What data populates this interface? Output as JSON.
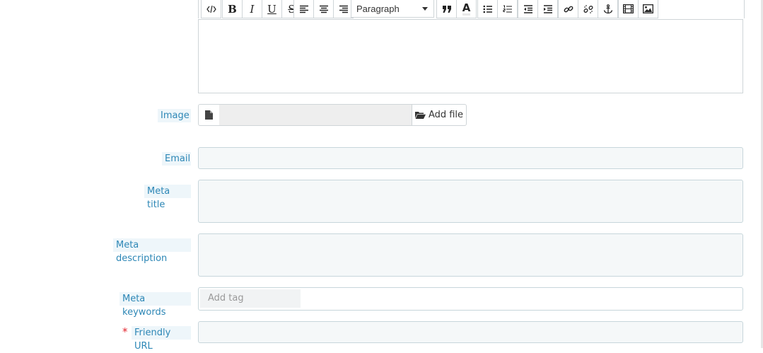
{
  "editor": {
    "toolbar": {
      "source_icon": "code-icon",
      "bold": "B",
      "italic": "I",
      "underline": "U",
      "strike": "S",
      "format_select": "Paragraph",
      "blockquote_icon": "blockquote-icon",
      "text_color": "A"
    },
    "content": ""
  },
  "form": {
    "image": {
      "label": "Image",
      "add_file": "Add file",
      "file_name": ""
    },
    "email": {
      "label": "Email",
      "value": ""
    },
    "meta_title": {
      "label": "Meta title",
      "value": ""
    },
    "meta_description": {
      "label": "Meta description",
      "value": ""
    },
    "meta_keywords": {
      "label": "Meta keywords",
      "placeholder": "Add tag"
    },
    "friendly_url": {
      "label": "Friendly URL",
      "required_mark": "*",
      "value": ""
    }
  },
  "colors": {
    "label_text": "#2d87b6",
    "label_bg": "#eef6fa",
    "input_bg": "#f5f8f9",
    "input_border": "#c7d6db",
    "required": "#e3262f"
  }
}
